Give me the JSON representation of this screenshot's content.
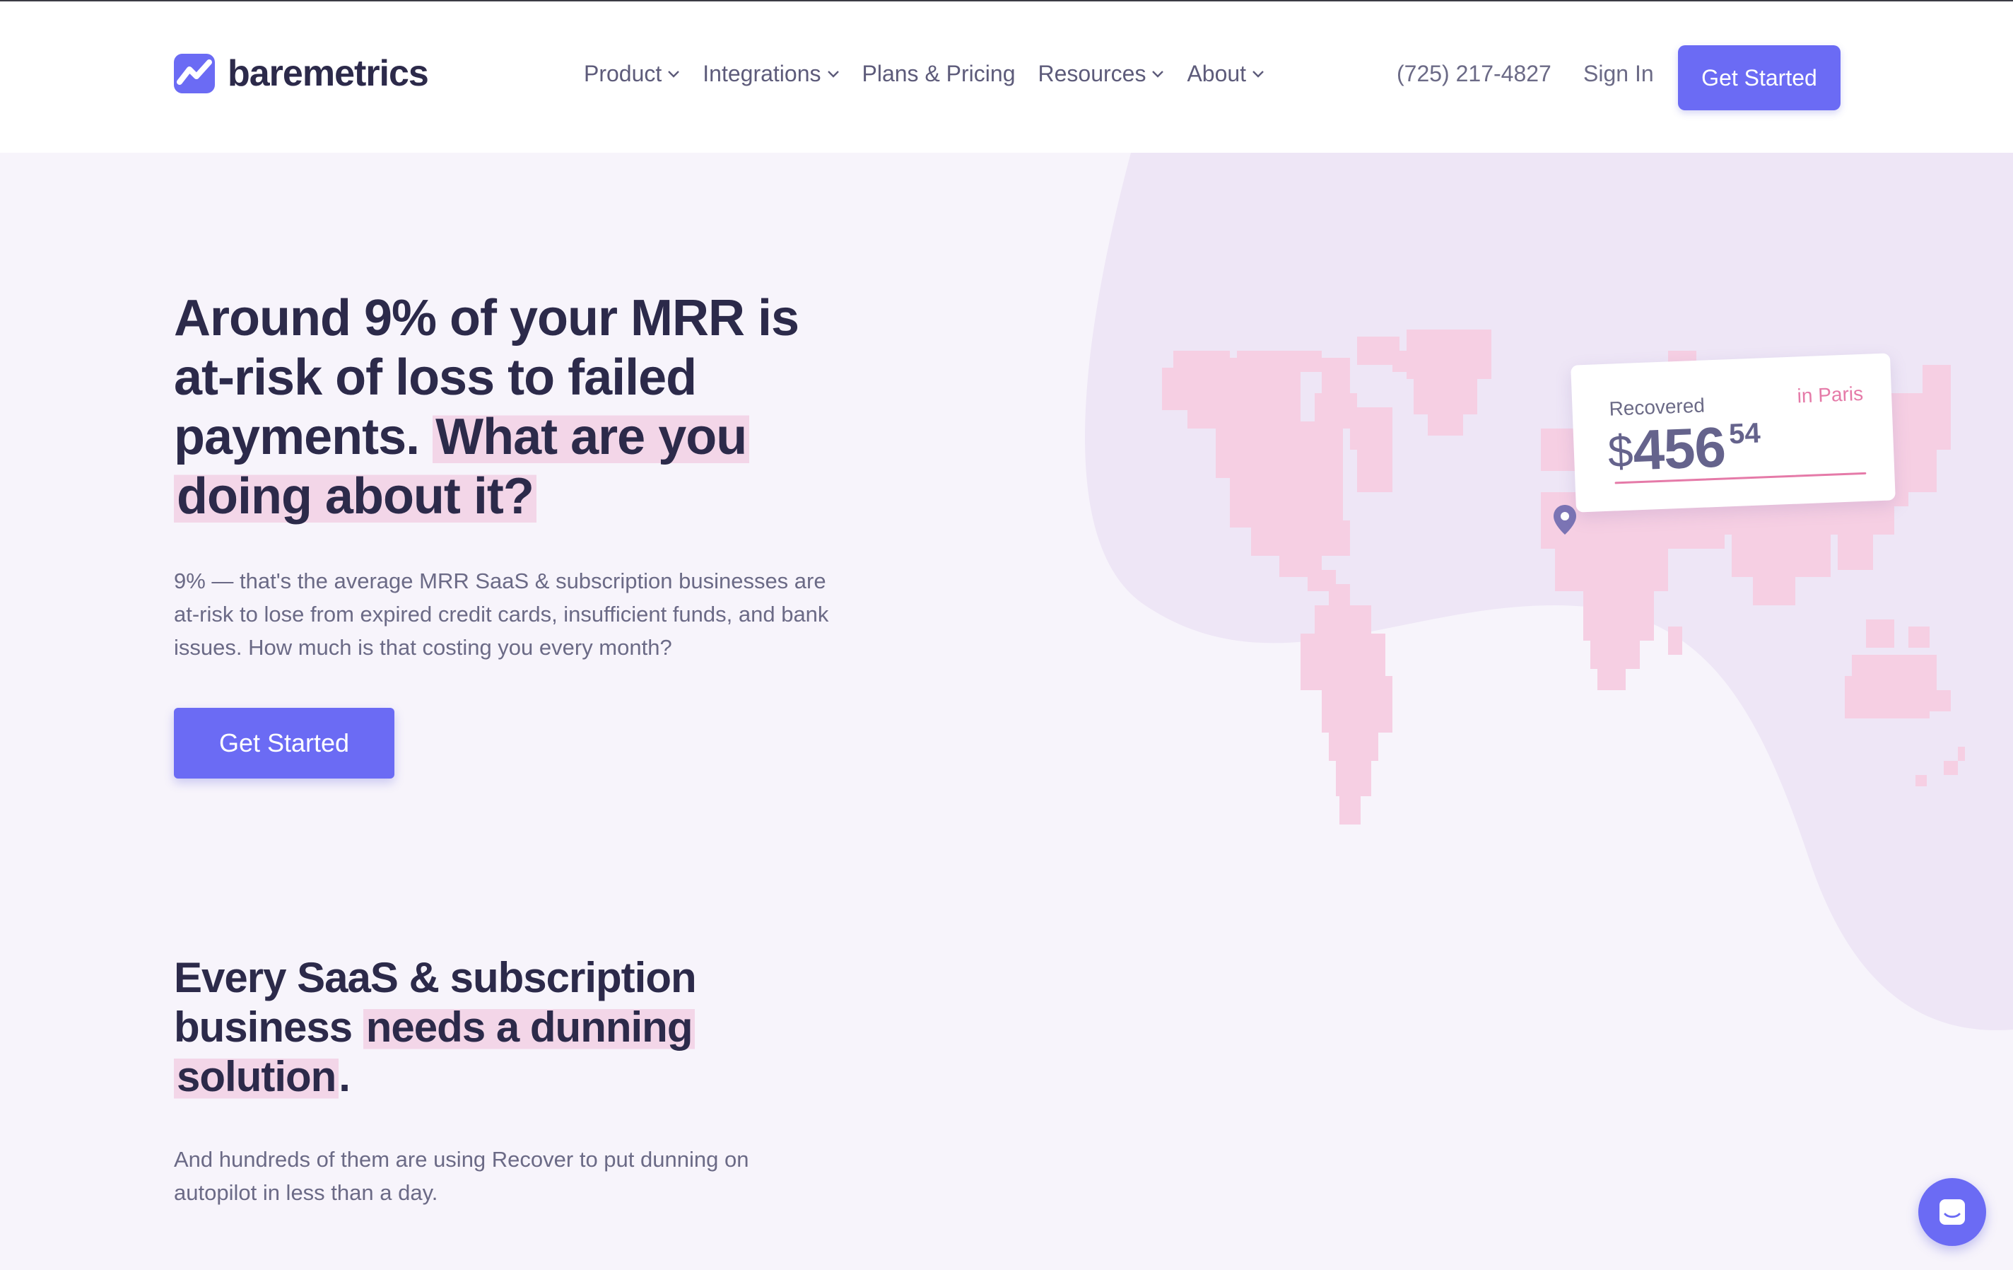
{
  "brand": {
    "name": "baremetrics",
    "logo_icon": "baremetrics-logo-icon"
  },
  "nav": {
    "items": [
      {
        "label": "Product",
        "has_dropdown": true
      },
      {
        "label": "Integrations",
        "has_dropdown": true
      },
      {
        "label": "Plans & Pricing",
        "has_dropdown": false
      },
      {
        "label": "Resources",
        "has_dropdown": true
      },
      {
        "label": "About",
        "has_dropdown": true
      }
    ],
    "phone": "(725) 217-4827",
    "sign_in": "Sign In",
    "cta": "Get Started"
  },
  "hero": {
    "heading_plain": "Around 9% of your MRR is at-risk of loss to failed payments.",
    "heading_highlight_1": "What are you",
    "heading_highlight_2": "doing about it?",
    "description": "9% — that's the average MRR SaaS & subscription businesses are at-risk to lose from expired credit cards, insufficient funds, and bank issues. How much is that costing you every month?",
    "cta": "Get Started"
  },
  "recovered_card": {
    "label": "Recovered",
    "city": "in Paris",
    "currency": "$",
    "amount": "456",
    "cents": "54"
  },
  "section2": {
    "heading_plain": "Every SaaS & subscription business",
    "heading_highlight_1": "needs a dunning",
    "heading_highlight_2": "solution",
    "heading_end": ".",
    "description": "And hundreds of them are using Recover to put dunning on autopilot in less than a day."
  },
  "chat_widget": {
    "icon": "chat-bubble-icon"
  },
  "colors": {
    "accent": "#6b6bf4",
    "heading": "#2c2a4a",
    "body_text": "#6b6a86",
    "highlight": "#f3d6e8",
    "map_pink": "#f6cfe3",
    "background": "#f7f4fb",
    "blob": "#eee6f6"
  }
}
